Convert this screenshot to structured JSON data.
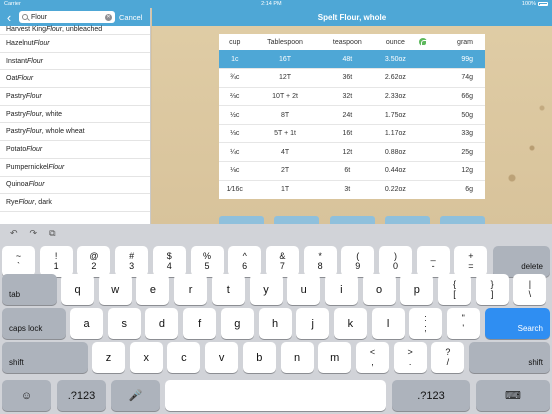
{
  "status_bar": {
    "carrier": "Carrier",
    "time": "2:14 PM",
    "battery": "100%"
  },
  "search": {
    "value": "Flour",
    "cancel_label": "Cancel"
  },
  "results": [
    {
      "pre": "Harvest King ",
      "it": "Flour",
      "post": ", unbleached"
    },
    {
      "pre": "Hazelnut ",
      "it": "Flour",
      "post": ""
    },
    {
      "pre": "Instant ",
      "it": "Flour",
      "post": ""
    },
    {
      "pre": "Oat ",
      "it": "Flour",
      "post": ""
    },
    {
      "pre": "Pastry ",
      "it": "Flour",
      "post": ""
    },
    {
      "pre": "Pastry ",
      "it": "Flour",
      "post": ", white"
    },
    {
      "pre": "Pastry ",
      "it": "Flour",
      "post": ", whole wheat"
    },
    {
      "pre": "Potato ",
      "it": "Flour",
      "post": ""
    },
    {
      "pre": "Pumpernickel ",
      "it": "Flour",
      "post": ""
    },
    {
      "pre": "Quinoa ",
      "it": "Flour",
      "post": ""
    },
    {
      "pre": "Rye ",
      "it": "Flour",
      "post": ", dark"
    }
  ],
  "detail": {
    "title": "Spelt Flour, whole",
    "columns": [
      "cup",
      "Tablespoon",
      "teaspoon",
      "ounce",
      "gram"
    ],
    "rows": [
      {
        "cup": "1c",
        "tbsp": "16T",
        "tsp": "48t",
        "oz": "3.50oz",
        "g": "99g"
      },
      {
        "cup": "¾c",
        "tbsp": "12T",
        "tsp": "36t",
        "oz": "2.62oz",
        "g": "74g"
      },
      {
        "cup": "⅔c",
        "tbsp": "10T + 2t",
        "tsp": "32t",
        "oz": "2.33oz",
        "g": "66g"
      },
      {
        "cup": "½c",
        "tbsp": "8T",
        "tsp": "24t",
        "oz": "1.75oz",
        "g": "50g"
      },
      {
        "cup": "⅓c",
        "tbsp": "5T + 1t",
        "tsp": "16t",
        "oz": "1.17oz",
        "g": "33g"
      },
      {
        "cup": "¼c",
        "tbsp": "4T",
        "tsp": "12t",
        "oz": "0.88oz",
        "g": "25g"
      },
      {
        "cup": "⅛c",
        "tbsp": "2T",
        "tsp": "6t",
        "oz": "0.44oz",
        "g": "12g"
      },
      {
        "cup": "1⁄16c",
        "tbsp": "1T",
        "tsp": "3t",
        "oz": "0.22oz",
        "g": "6g"
      }
    ]
  },
  "keyboard": {
    "toolbar": [
      "↶",
      "↷",
      "⧉"
    ],
    "row1": [
      [
        "~",
        "`"
      ],
      [
        "!",
        "1"
      ],
      [
        "@",
        "2"
      ],
      [
        "#",
        "3"
      ],
      [
        "$",
        "4"
      ],
      [
        "%",
        "5"
      ],
      [
        "^",
        "6"
      ],
      [
        "&",
        "7"
      ],
      [
        "*",
        "8"
      ],
      [
        "(",
        "9"
      ],
      [
        ")",
        "0"
      ],
      [
        "_",
        "-"
      ],
      [
        "+",
        "="
      ]
    ],
    "delete_label": "delete",
    "tab_label": "tab",
    "row2": [
      "q",
      "w",
      "e",
      "r",
      "t",
      "y",
      "u",
      "i",
      "o",
      "p"
    ],
    "row2_extra": [
      [
        "{",
        "["
      ],
      [
        "}",
        "]"
      ],
      [
        "|",
        "\\"
      ]
    ],
    "caps_label": "caps lock",
    "row3": [
      "a",
      "s",
      "d",
      "f",
      "g",
      "h",
      "j",
      "k",
      "l"
    ],
    "row3_extra": [
      [
        ":",
        ";"
      ],
      [
        "\"",
        "'"
      ]
    ],
    "search_label": "Search",
    "shift_label": "shift",
    "row4": [
      "z",
      "x",
      "c",
      "v",
      "b",
      "n",
      "m"
    ],
    "row4_extra": [
      [
        "<",
        ","
      ],
      [
        ">",
        "."
      ],
      [
        "?",
        "/"
      ]
    ],
    "numbers_label": ".?123",
    "emoji_icon": "☺",
    "mic_icon": "🎤",
    "dismiss_icon": "⌨"
  }
}
